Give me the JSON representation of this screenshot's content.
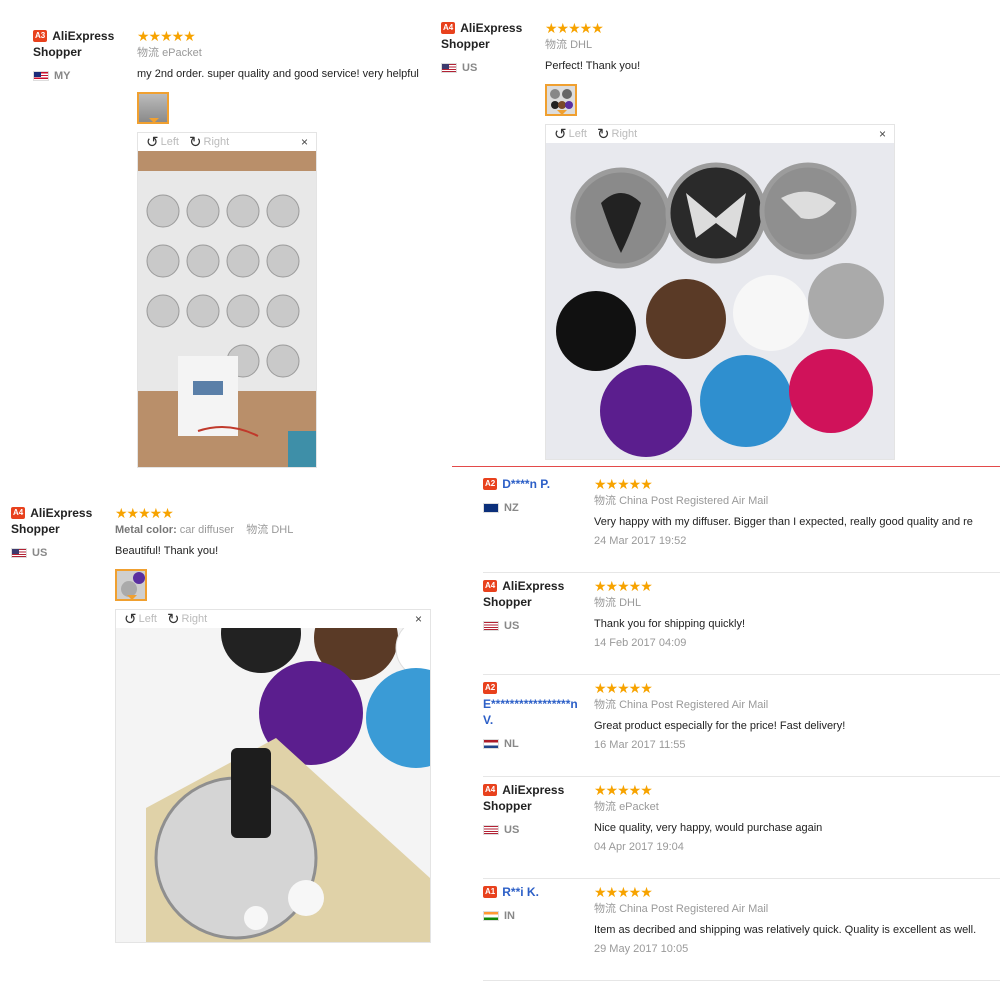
{
  "reviews": [
    {
      "level": "A3",
      "user": "AliExpress Shopper",
      "country": "MY",
      "stars": "★★★★★",
      "ship_label": "物流",
      "shipping": "ePacket",
      "feedback": "my 2nd order. super quality and good service! very helpful",
      "viewer": {
        "left": "Left",
        "right": "Right",
        "close": "×"
      }
    },
    {
      "level": "A4",
      "user": "AliExpress Shopper",
      "country": "US",
      "stars": "★★★★★",
      "ship_label": "物流",
      "shipping": "DHL",
      "feedback": "Perfect! Thank you!",
      "viewer": {
        "left": "Left",
        "right": "Right",
        "close": "×"
      }
    },
    {
      "level": "A4",
      "user": "AliExpress Shopper",
      "country": "US",
      "stars": "★★★★★",
      "color_label": "Metal color:",
      "color_value": "car diffuser",
      "ship_label": "物流",
      "shipping": "DHL",
      "feedback": "Beautiful! Thank you!",
      "viewer": {
        "left": "Left",
        "right": "Right",
        "close": "×"
      }
    }
  ],
  "list": [
    {
      "level": "A2",
      "user": "D****n P.",
      "country": "NZ",
      "stars": "★★★★★",
      "ship_label": "物流",
      "shipping": "China Post Registered Air Mail",
      "feedback": "Very happy with my diffuser. Bigger than I expected, really good quality and re",
      "date": "24 Mar 2017 19:52"
    },
    {
      "level": "A4",
      "user": "AliExpress Shopper",
      "country": "US",
      "stars": "★★★★★",
      "ship_label": "物流",
      "shipping": "DHL",
      "feedback": "Thank you for shipping quickly!",
      "date": "14 Feb 2017 04:09"
    },
    {
      "level": "A2",
      "user": "E*****************n V.",
      "country": "NL",
      "stars": "★★★★★",
      "ship_label": "物流",
      "shipping": "China Post Registered Air Mail",
      "feedback": "Great product especially for the price! Fast delivery!",
      "date": "16 Mar 2017 11:55"
    },
    {
      "level": "A4",
      "user": "AliExpress Shopper",
      "country": "US",
      "stars": "★★★★★",
      "ship_label": "物流",
      "shipping": "ePacket",
      "feedback": "Nice quality, very happy, would purchase again",
      "date": "04 Apr 2017 19:04"
    },
    {
      "level": "A1",
      "user": "R**i K.",
      "country": "IN",
      "stars": "★★★★★",
      "ship_label": "物流",
      "shipping": "China Post Registered Air Mail",
      "feedback": "Item as decribed and shipping was relatively quick. Quality is excellent as well.",
      "date": "29 May 2017 10:05"
    }
  ],
  "colors": {
    "badge": "#e8411d",
    "stars": "#f7a300",
    "link": "#2c5fc7"
  }
}
